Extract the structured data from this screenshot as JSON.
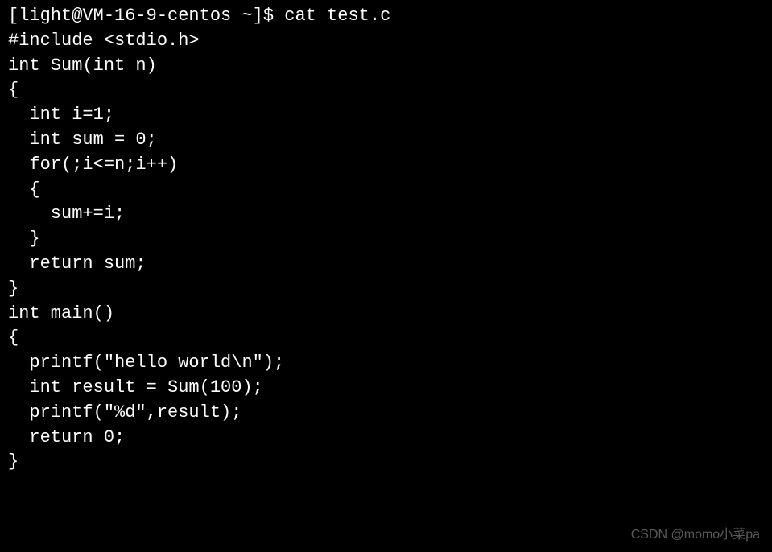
{
  "terminal": {
    "prompt": "[light@VM-16-9-centos ~]$ ",
    "command": "cat test.c",
    "lines": [
      "#include <stdio.h>",
      "",
      "int Sum(int n)",
      "{",
      "  int i=1;",
      "  int sum = 0;",
      "  for(;i<=n;i++)",
      "  {",
      "    sum+=i;",
      "  }",
      "  return sum;",
      "}",
      "int main()",
      "{",
      "  printf(\"hello world\\n\");",
      "  int result = Sum(100);",
      "  printf(\"%d\",result);",
      "  return 0;",
      "}"
    ]
  },
  "watermark": "CSDN @momo小菜pa"
}
